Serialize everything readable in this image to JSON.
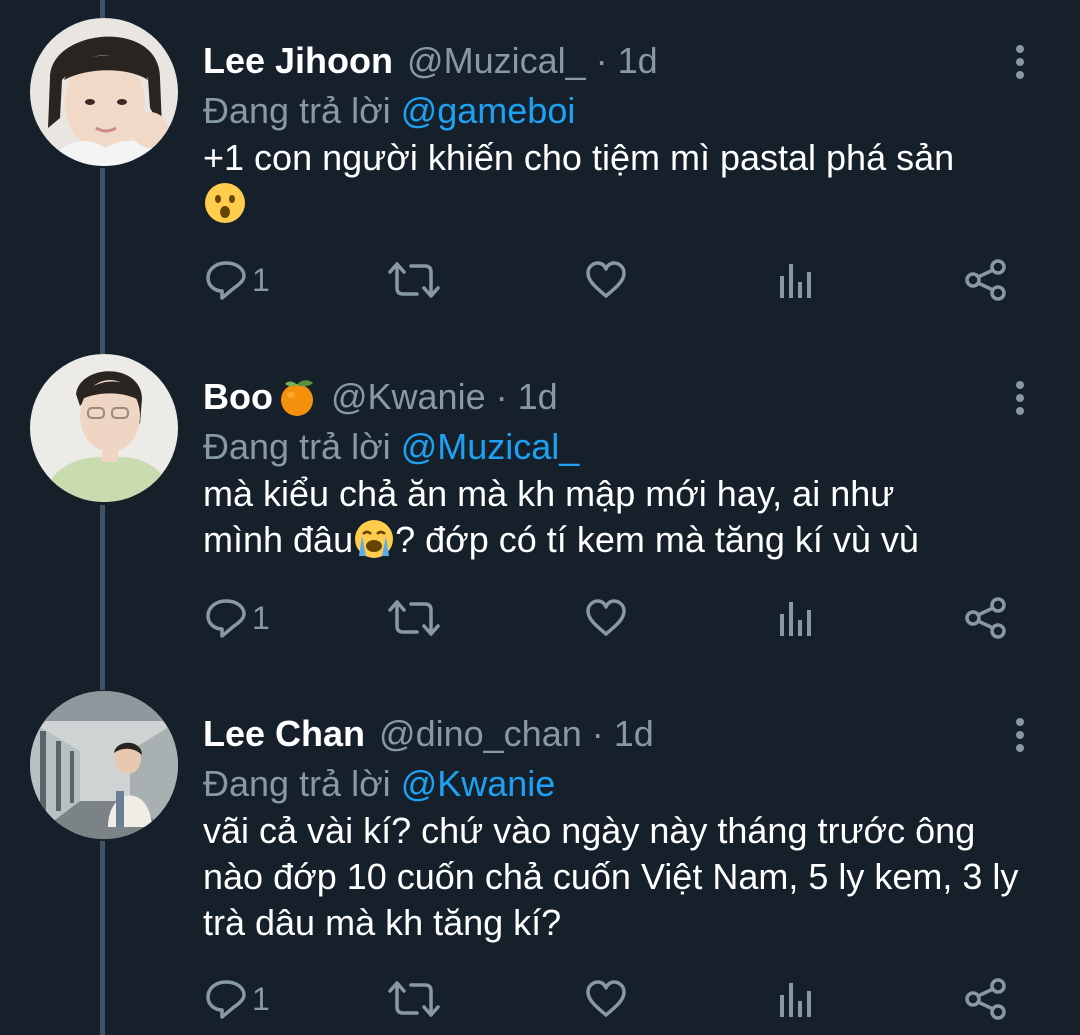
{
  "tweets": [
    {
      "name": "Lee Jihoon",
      "handle": "@Muzical_",
      "separator": "·",
      "time": "1d",
      "replying_prefix": "Đang trả lời",
      "replying_to": "@gameboi",
      "text": "+1 con người khiến cho tiệm mì pastal phá sản",
      "text_emoji": "astonished-face-emoji",
      "reply_count": "1",
      "avatar": "lee-jihoon-avatar"
    },
    {
      "name": "Boo",
      "name_emoji": "tangerine-emoji",
      "handle": "@Kwanie",
      "separator": "·",
      "time": "1d",
      "replying_prefix": "Đang trả lời",
      "replying_to": "@Muzical_",
      "text_line1": "mà kiểu chả ăn mà kh mập mới hay, ai như",
      "text_line2a": "mình đâu",
      "text_emoji": "crying-face-emoji",
      "text_line2b": "? đớp có tí kem mà tăng kí vù vù",
      "reply_count": "1",
      "avatar": "boo-avatar"
    },
    {
      "name": "Lee Chan",
      "handle": "@dino_chan",
      "separator": "·",
      "time": "1d",
      "replying_prefix": "Đang trả lời",
      "replying_to": "@Kwanie",
      "text": "vãi cả vài kí? chứ vào ngày này tháng trước ông nào đớp 10 cuốn chả cuốn Việt Nam, 5 ly kem, 3 ly trà dâu mà kh tăng kí?",
      "reply_count": "1",
      "avatar": "lee-chan-avatar"
    }
  ],
  "icons": {
    "reply": "reply-icon",
    "retweet": "retweet-icon",
    "like": "heart-icon",
    "analytics": "analytics-icon",
    "share": "share-icon",
    "more": "more-vertical-icon"
  },
  "colors": {
    "background": "#15202b",
    "secondary_text": "#8899a6",
    "accent": "#1da1f2",
    "thread_line": "#3d5466"
  }
}
